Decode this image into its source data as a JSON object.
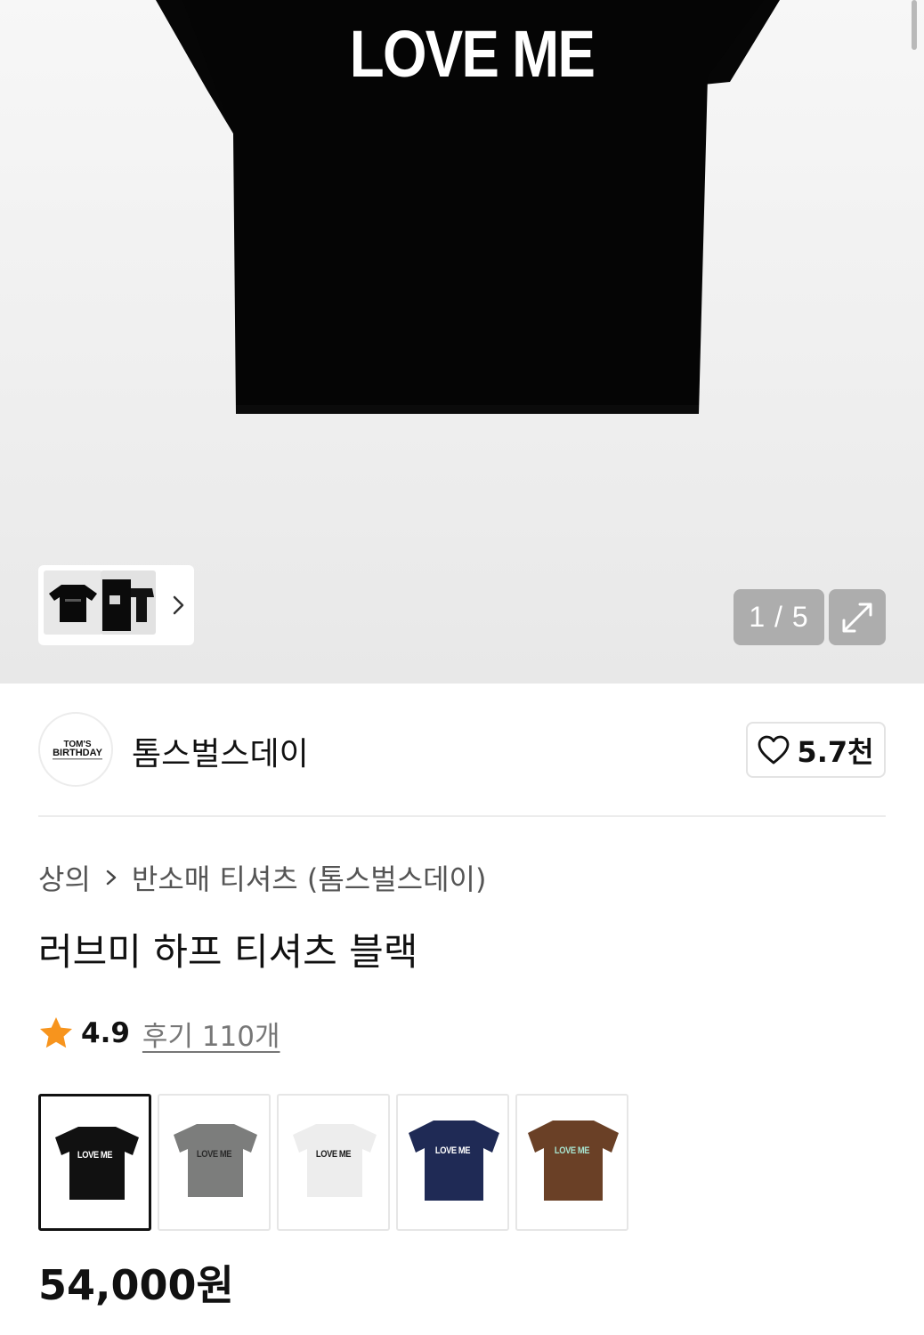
{
  "gallery": {
    "print_text": "LOVE ME",
    "page_counter": "1 / 5",
    "thumbnails": [
      "thumbnail-black-tee",
      "thumbnail-black-tee-alt"
    ],
    "icons": [
      "chevron-right-icon",
      "expand-icon"
    ]
  },
  "brand": {
    "logo_top": "TOM'S",
    "logo_main": "BIRTHDAY",
    "name": "톰스벌스데이",
    "like_count": "5.7천",
    "like_icon": "heart-icon"
  },
  "product": {
    "breadcrumb": [
      "상의",
      "반소매 티셔츠 (톰스벌스데이)"
    ],
    "title": "러브미 하프 티셔츠 블랙",
    "rating": "4.9",
    "review_link": "후기 110개",
    "price": "54,000원"
  },
  "swatches": [
    {
      "color": "#111111",
      "text": "LOVE ME",
      "text_color": "#ffffff",
      "selected": true
    },
    {
      "color": "#7c7d7c",
      "text": "LOVE ME",
      "text_color": "#2b2b2b",
      "selected": false
    },
    {
      "color": "#ededed",
      "text": "LOVE ME",
      "text_color": "#1b1b1b",
      "selected": false
    },
    {
      "color": "#1f2a55",
      "text": "LOVE ME",
      "text_color": "#ffffff",
      "selected": false
    },
    {
      "color": "#6a4026",
      "text": "LOVE ME",
      "text_color": "#a7e3cf",
      "selected": false
    }
  ],
  "colors": {
    "star": "#f7941d",
    "overlay": "#969696"
  }
}
